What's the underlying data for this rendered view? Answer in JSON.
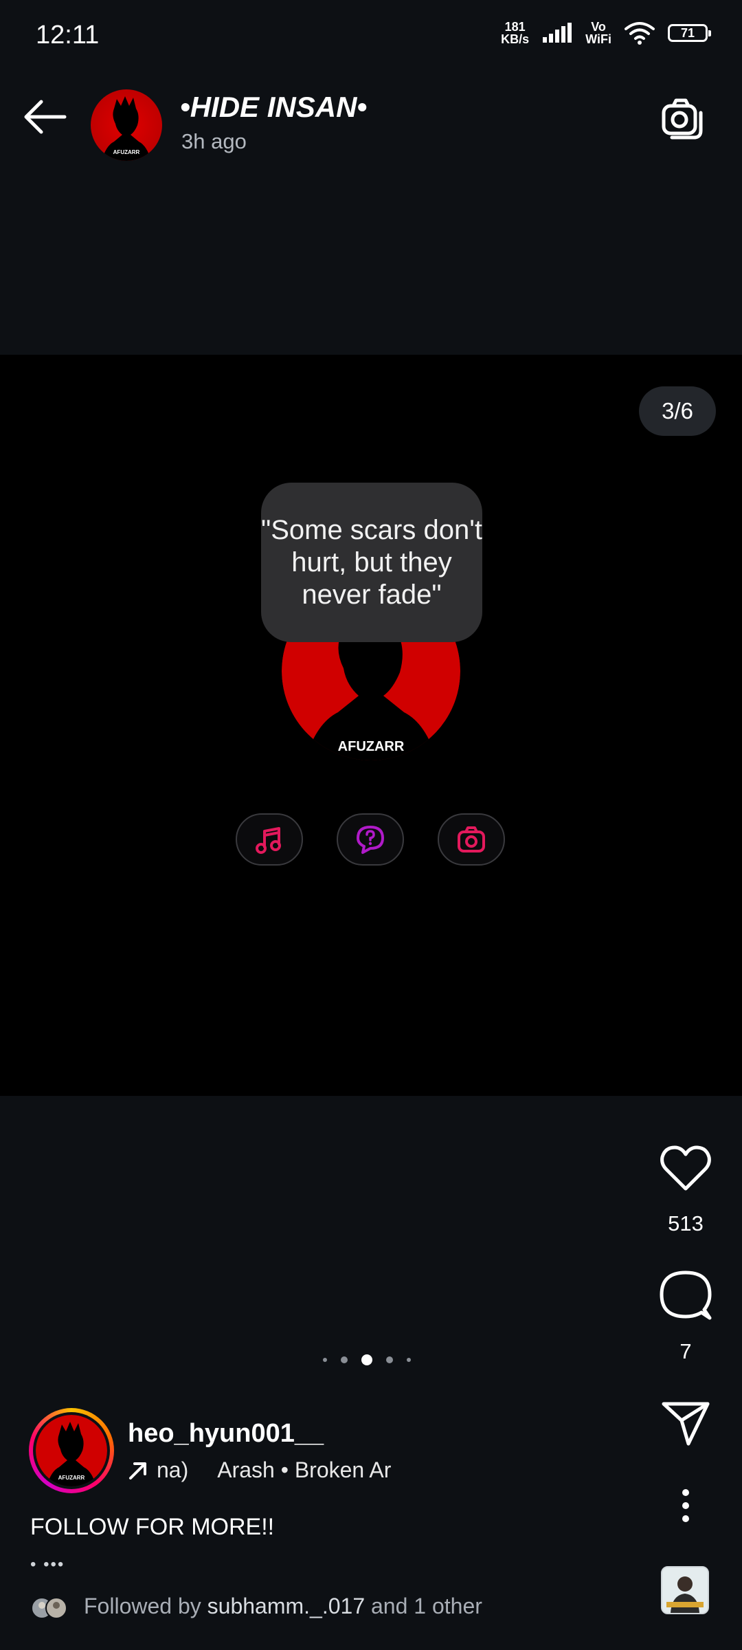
{
  "status_bar": {
    "time": "12:11",
    "speed_value": "181",
    "speed_unit": "KB/s",
    "vo": "Vo",
    "wifi_label": "WiFi",
    "battery": "71"
  },
  "header": {
    "title": "•HIDE INSAN•",
    "time_ago": "3h ago"
  },
  "story": {
    "counter": "3/6",
    "quote": "\"Some scars don't hurt, but they never fade\"",
    "avatar_label": "AFUZARR"
  },
  "actions": {
    "likes": "513",
    "comments": "7"
  },
  "pagination": {
    "total": 5,
    "active_index": 2
  },
  "author": {
    "username": "heo_hyun001__",
    "music_prefix": "na)",
    "music_track": "Arash • Broken Ar",
    "caption": "FOLLOW FOR MORE!!",
    "more": "• •••",
    "followed_prefix": "Followed by ",
    "followed_user": "subhamm._.017",
    "followed_suffix": " and 1 other"
  },
  "colors": {
    "background": "#0d1014",
    "media_background": "#000000",
    "accent_pink": "#e3195c",
    "accent_purple": "#b01ac8",
    "avatar_red": "#d00000"
  },
  "icons": {
    "back": "arrow-left-icon",
    "camera": "camera-icon",
    "like": "heart-icon",
    "comment": "comment-icon",
    "share": "send-icon",
    "more": "more-vertical-icon",
    "music": "music-note-icon",
    "question": "question-bubble-icon"
  }
}
